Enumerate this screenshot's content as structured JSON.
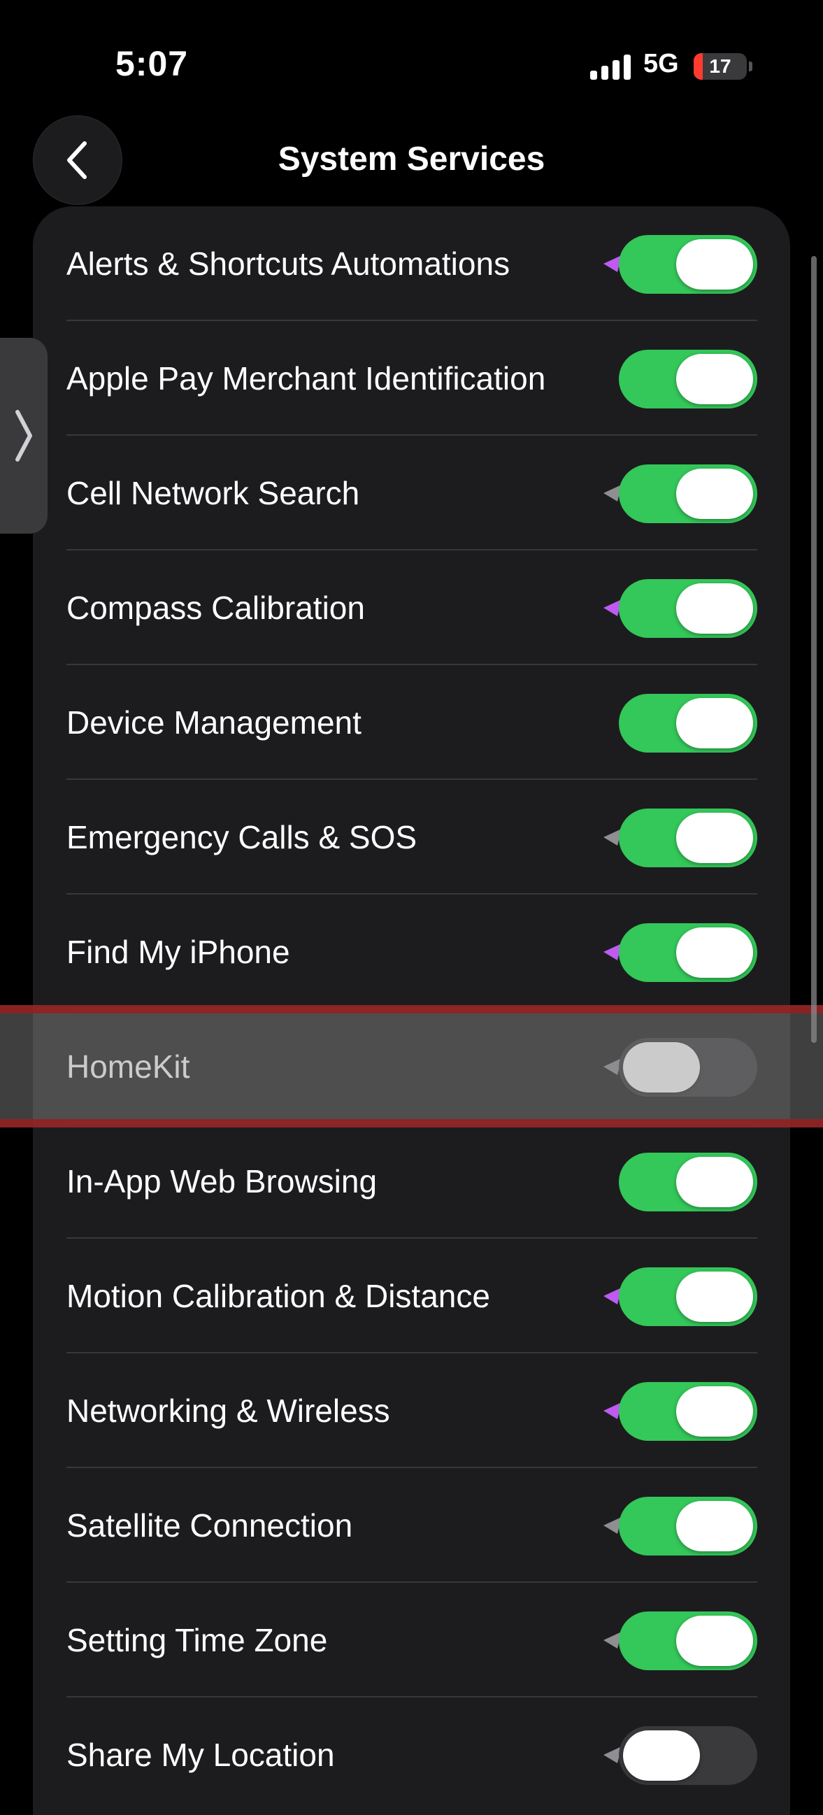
{
  "status_bar": {
    "time": "5:07",
    "network": "5G",
    "battery_level": "17",
    "battery_fraction": 0.17,
    "battery_color": "#ff3b30"
  },
  "nav": {
    "back_icon": "chevron-left-icon",
    "title": "System Services"
  },
  "colors": {
    "toggle_on": "#34c759",
    "toggle_off": "#3a3a3c",
    "location_arrow_purple": "#bf5af2",
    "location_arrow_gray": "#8e8e93",
    "highlight_border": "#961e1e"
  },
  "services": [
    {
      "label": "Alerts & Shortcuts Automations",
      "enabled": true,
      "location_indicator": "purple"
    },
    {
      "label": "Apple Pay Merchant Identification",
      "enabled": true,
      "location_indicator": "none"
    },
    {
      "label": "Cell Network Search",
      "enabled": true,
      "location_indicator": "gray"
    },
    {
      "label": "Compass Calibration",
      "enabled": true,
      "location_indicator": "purple"
    },
    {
      "label": "Device Management",
      "enabled": true,
      "location_indicator": "none"
    },
    {
      "label": "Emergency Calls & SOS",
      "enabled": true,
      "location_indicator": "gray"
    },
    {
      "label": "Find My iPhone",
      "enabled": true,
      "location_indicator": "purple"
    },
    {
      "label": "HomeKit",
      "enabled": false,
      "location_indicator": "gray",
      "highlighted": true
    },
    {
      "label": "In-App Web Browsing",
      "enabled": true,
      "location_indicator": "none"
    },
    {
      "label": "Motion Calibration & Distance",
      "enabled": true,
      "location_indicator": "purple"
    },
    {
      "label": "Networking & Wireless",
      "enabled": true,
      "location_indicator": "purple"
    },
    {
      "label": "Satellite Connection",
      "enabled": true,
      "location_indicator": "gray"
    },
    {
      "label": "Setting Time Zone",
      "enabled": true,
      "location_indicator": "gray"
    },
    {
      "label": "Share My Location",
      "enabled": false,
      "location_indicator": "gray"
    }
  ]
}
